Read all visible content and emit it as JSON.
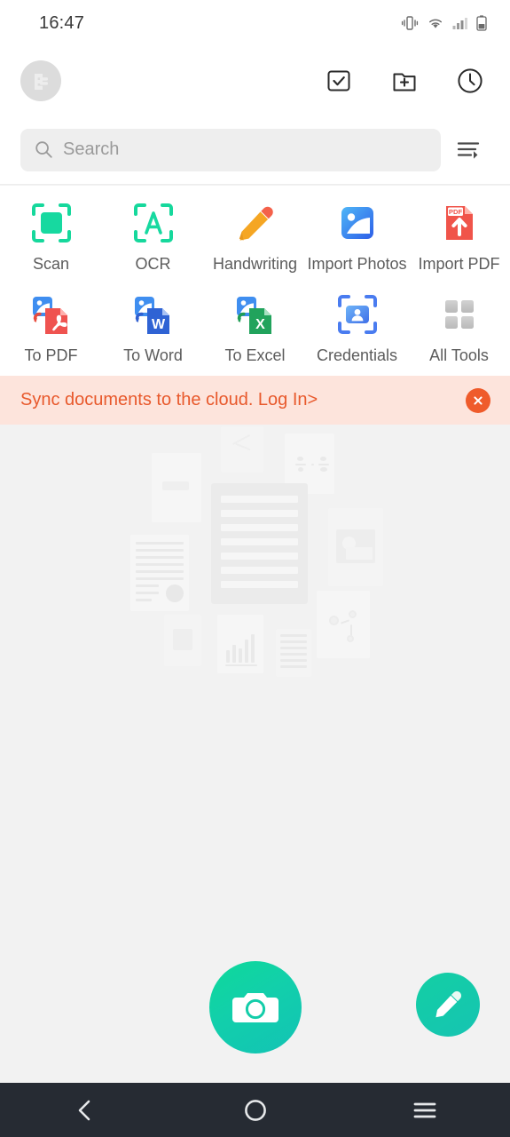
{
  "status_bar": {
    "time": "16:47",
    "icons": [
      "vibrate-icon",
      "wifi-icon",
      "signal-icon",
      "battery-icon"
    ]
  },
  "header": {
    "avatar_name": "app-logo-avatar",
    "actions": [
      {
        "name": "select-checkbox-button",
        "icon": "checkbox-check-icon"
      },
      {
        "name": "new-folder-button",
        "icon": "folder-plus-icon"
      },
      {
        "name": "recent-button",
        "icon": "clock-icon"
      }
    ]
  },
  "search": {
    "placeholder": "Search",
    "icon": "search-icon",
    "sort_icon": "sort-filter-icon"
  },
  "tools": {
    "row1": [
      {
        "label": "Scan",
        "icon": "scan-frame-icon"
      },
      {
        "label": "OCR",
        "icon": "ocr-a-frame-icon"
      },
      {
        "label": "Handwriting",
        "icon": "pencil-icon"
      },
      {
        "label": "Import Photos",
        "icon": "photo-icon"
      },
      {
        "label": "Import PDF",
        "icon": "pdf-upload-icon"
      }
    ],
    "row2": [
      {
        "label": "To PDF",
        "icon": "photo-to-pdf-icon"
      },
      {
        "label": "To Word",
        "icon": "photo-to-word-icon"
      },
      {
        "label": "To Excel",
        "icon": "photo-to-excel-icon"
      },
      {
        "label": "Credentials",
        "icon": "id-card-scan-icon"
      },
      {
        "label": "All Tools",
        "icon": "grid-squares-icon"
      }
    ]
  },
  "banner": {
    "message": "Sync documents to the cloud. Log In>",
    "close_icon": "close-circle-icon"
  },
  "empty_state": {
    "illustration": "scattered-documents-watermark"
  },
  "fabs": {
    "camera": {
      "name": "camera-fab",
      "icon": "camera-icon"
    },
    "edit": {
      "name": "edit-fab",
      "icon": "pencil-icon"
    }
  },
  "nav_bar": {
    "back": {
      "label": "Back",
      "icon": "chevron-left-icon"
    },
    "home": {
      "label": "Home",
      "icon": "circle-icon"
    },
    "recents": {
      "label": "Recents",
      "icon": "hamburger-icon"
    }
  },
  "colors": {
    "accent_green": "#13c9a8",
    "banner_bg": "#fde4dc",
    "banner_text": "#e8592c",
    "page_bg": "#f2f2f2",
    "nav_bg": "#262b33"
  }
}
